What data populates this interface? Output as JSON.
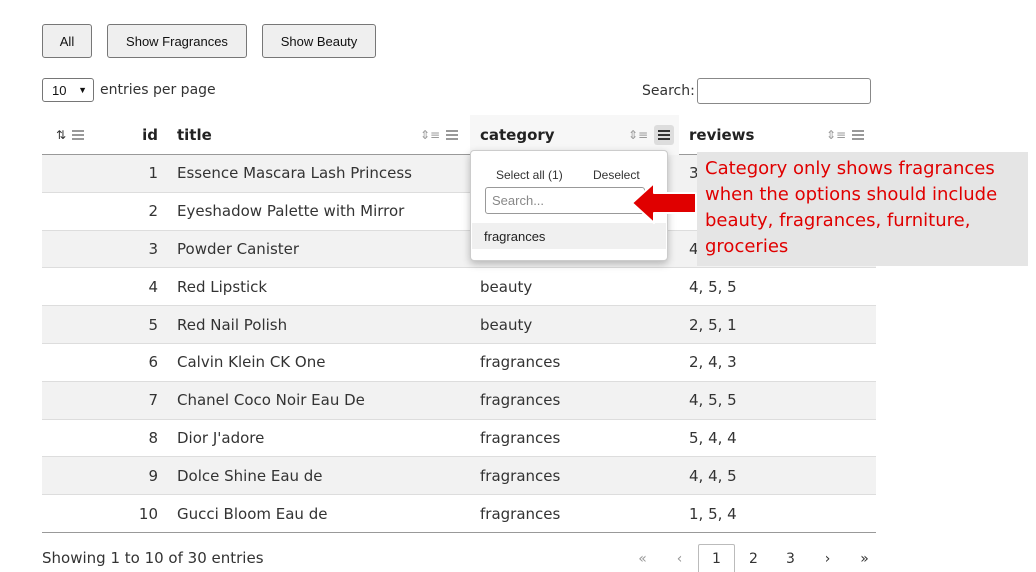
{
  "buttons": {
    "all": "All",
    "show_fragrances": "Show Fragrances",
    "show_beauty": "Show Beauty"
  },
  "length_menu": {
    "value": "10",
    "label": "entries per page"
  },
  "search": {
    "label": "Search:",
    "value": ""
  },
  "table": {
    "columns": {
      "id": "id",
      "title": "title",
      "category": "category",
      "reviews": "reviews"
    },
    "rows": [
      {
        "id": "1",
        "title": "Essence Mascara Lash Princess",
        "category": "",
        "reviews": "3"
      },
      {
        "id": "2",
        "title": "Eyeshadow Palette with Mirror",
        "category": "",
        "reviews": ""
      },
      {
        "id": "3",
        "title": "Powder Canister",
        "category": "",
        "reviews": "4"
      },
      {
        "id": "4",
        "title": "Red Lipstick",
        "category": "beauty",
        "reviews": "4, 5, 5"
      },
      {
        "id": "5",
        "title": "Red Nail Polish",
        "category": "beauty",
        "reviews": "2, 5, 1"
      },
      {
        "id": "6",
        "title": "Calvin Klein CK One",
        "category": "fragrances",
        "reviews": "2, 4, 3"
      },
      {
        "id": "7",
        "title": "Chanel Coco Noir Eau De",
        "category": "fragrances",
        "reviews": "4, 5, 5"
      },
      {
        "id": "8",
        "title": "Dior J'adore",
        "category": "fragrances",
        "reviews": "5, 4, 4"
      },
      {
        "id": "9",
        "title": "Dolce Shine Eau de",
        "category": "fragrances",
        "reviews": "4, 4, 5"
      },
      {
        "id": "10",
        "title": "Gucci Bloom Eau de",
        "category": "fragrances",
        "reviews": "1, 5, 4"
      }
    ]
  },
  "info": "Showing 1 to 10 of 30 entries",
  "pagination": {
    "first": "«",
    "prev": "‹",
    "pages": [
      "1",
      "2",
      "3"
    ],
    "current": "1",
    "next": "›",
    "last": "»"
  },
  "filter_dropdown": {
    "select_all": "Select all (1)",
    "deselect": "Deselect",
    "search_placeholder": "Search...",
    "options": [
      "fragrances"
    ]
  },
  "annotation": {
    "lines": [
      "Category only shows fragrances",
      "when the options should include",
      "beauty, fragrances, furniture,",
      "groceries"
    ],
    "color": "#e00000"
  },
  "icons": {
    "sort": "sort-icon",
    "menu": "menu-icon",
    "arrow": "red-arrow-icon"
  }
}
